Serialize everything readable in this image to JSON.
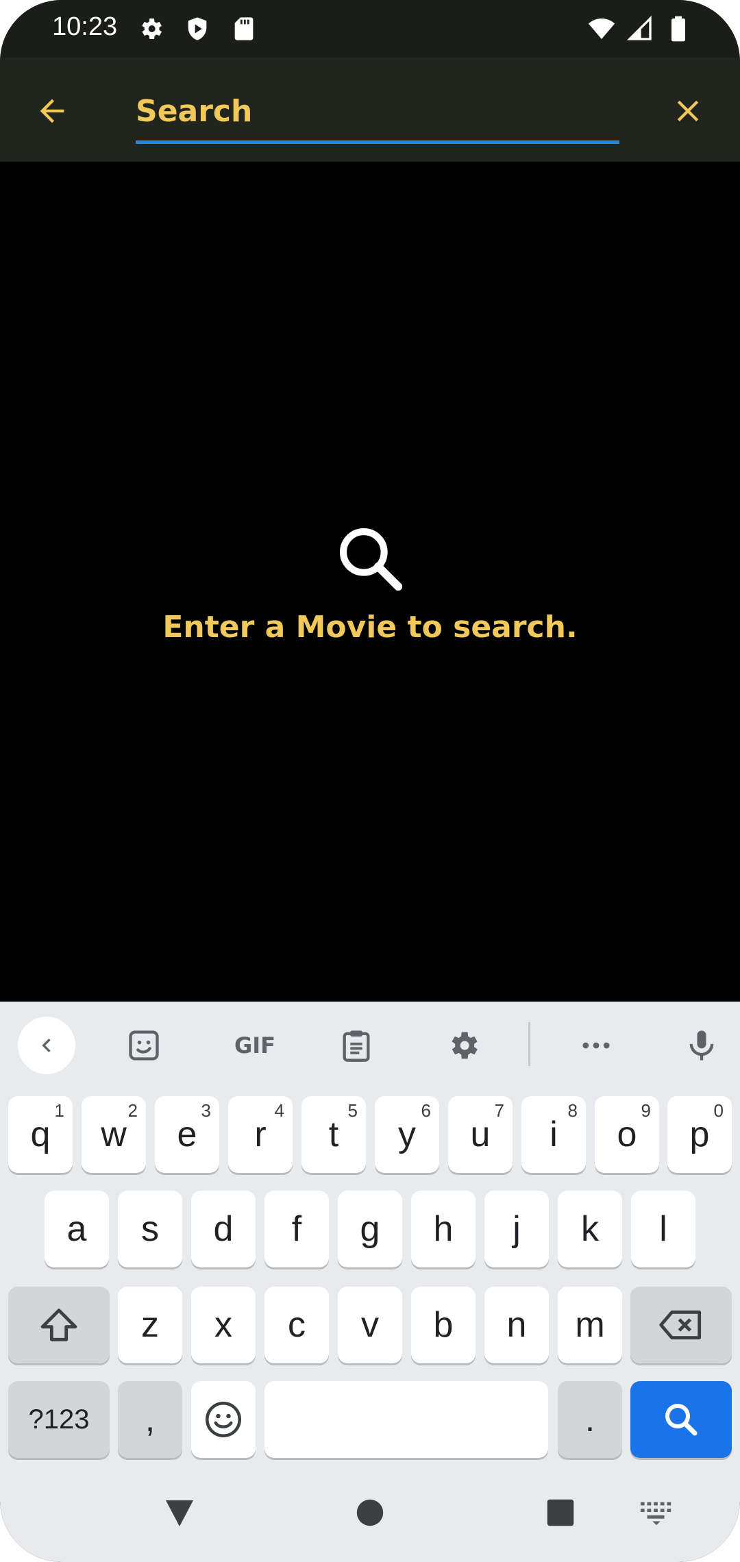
{
  "status_bar": {
    "time": "10:23",
    "icons_left": [
      "settings-icon",
      "shield-icon",
      "sd-card-icon"
    ],
    "icons_right": [
      "wifi-icon",
      "signal-icon",
      "battery-icon"
    ]
  },
  "app_bar": {
    "back_icon": "arrow-left-icon",
    "search_placeholder": "Search",
    "search_value": "",
    "close_icon": "close-icon",
    "accent_color": "#f1c95b",
    "underline_color": "#1e88e5"
  },
  "empty_state": {
    "icon": "search-icon",
    "message": "Enter a Movie to search."
  },
  "keyboard": {
    "toolbar": {
      "gif_label": "GIF"
    },
    "row1": [
      {
        "label": "q",
        "hint": "1"
      },
      {
        "label": "w",
        "hint": "2"
      },
      {
        "label": "e",
        "hint": "3"
      },
      {
        "label": "r",
        "hint": "4"
      },
      {
        "label": "t",
        "hint": "5"
      },
      {
        "label": "y",
        "hint": "6"
      },
      {
        "label": "u",
        "hint": "7"
      },
      {
        "label": "i",
        "hint": "8"
      },
      {
        "label": "o",
        "hint": "9"
      },
      {
        "label": "p",
        "hint": "0"
      }
    ],
    "row2": [
      "a",
      "s",
      "d",
      "f",
      "g",
      "h",
      "j",
      "k",
      "l"
    ],
    "row3": [
      "z",
      "x",
      "c",
      "v",
      "b",
      "n",
      "m"
    ],
    "row4": {
      "symbols": "?123",
      "comma": ",",
      "period": "."
    }
  }
}
